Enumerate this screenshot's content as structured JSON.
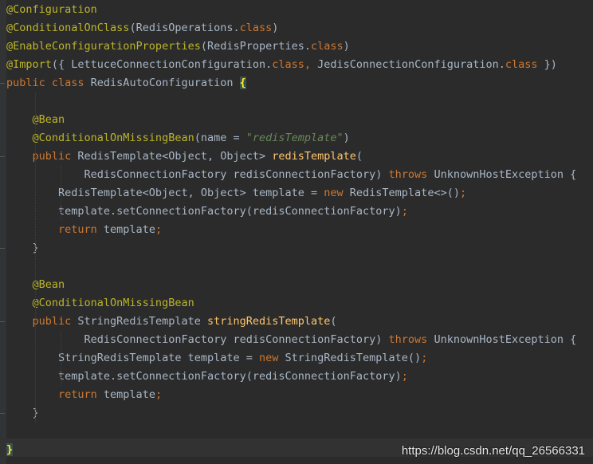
{
  "editor": {
    "lines": [
      [
        {
          "t": "@Configuration",
          "c": "ann"
        }
      ],
      [
        {
          "t": "@ConditionalOnClass",
          "c": "ann"
        },
        {
          "t": "(RedisOperations.",
          "c": "plain"
        },
        {
          "t": "class",
          "c": "kw"
        },
        {
          "t": ")",
          "c": "plain"
        }
      ],
      [
        {
          "t": "@EnableConfigurationProperties",
          "c": "ann"
        },
        {
          "t": "(RedisProperties.",
          "c": "plain"
        },
        {
          "t": "class",
          "c": "kw"
        },
        {
          "t": ")",
          "c": "plain"
        }
      ],
      [
        {
          "t": "@Import",
          "c": "ann"
        },
        {
          "t": "({ LettuceConnectionConfiguration.",
          "c": "plain"
        },
        {
          "t": "class",
          "c": "kw"
        },
        {
          "t": ", ",
          "c": "kw"
        },
        {
          "t": "JedisConnectionConfiguration.",
          "c": "plain"
        },
        {
          "t": "class",
          "c": "kw"
        },
        {
          "t": " })",
          "c": "plain"
        }
      ],
      [
        {
          "t": "public class ",
          "c": "kw"
        },
        {
          "t": "RedisAutoConfiguration ",
          "c": "plain"
        },
        {
          "t": "{",
          "c": "brace-hl"
        }
      ],
      [],
      [
        {
          "t": "    @Bean",
          "c": "ann"
        }
      ],
      [
        {
          "t": "    @ConditionalOnMissingBean",
          "c": "ann"
        },
        {
          "t": "(name = ",
          "c": "plain"
        },
        {
          "t": "\"redisTemplate\"",
          "c": "str"
        },
        {
          "t": ")",
          "c": "plain"
        }
      ],
      [
        {
          "t": "    public ",
          "c": "kw"
        },
        {
          "t": "RedisTemplate<Object, Object> ",
          "c": "plain"
        },
        {
          "t": "redisTemplate",
          "c": "fn"
        },
        {
          "t": "(",
          "c": "plain"
        }
      ],
      [
        {
          "t": "            RedisConnectionFactory redisConnectionFactory) ",
          "c": "plain"
        },
        {
          "t": "throws ",
          "c": "kw"
        },
        {
          "t": "UnknownHostException {",
          "c": "plain"
        }
      ],
      [
        {
          "t": "        RedisTemplate<Object, Object> template = ",
          "c": "plain"
        },
        {
          "t": "new ",
          "c": "kw"
        },
        {
          "t": "RedisTemplate<>()",
          "c": "plain"
        },
        {
          "t": ";",
          "c": "kw"
        }
      ],
      [
        {
          "t": "        template.setConnectionFactory(redisConnectionFactory)",
          "c": "plain"
        },
        {
          "t": ";",
          "c": "kw"
        }
      ],
      [
        {
          "t": "        return ",
          "c": "kw"
        },
        {
          "t": "template",
          "c": "plain"
        },
        {
          "t": ";",
          "c": "kw"
        }
      ],
      [
        {
          "t": "    }",
          "c": "plain"
        }
      ],
      [],
      [
        {
          "t": "    @Bean",
          "c": "ann"
        }
      ],
      [
        {
          "t": "    @ConditionalOnMissingBean",
          "c": "ann"
        }
      ],
      [
        {
          "t": "    public ",
          "c": "kw"
        },
        {
          "t": "StringRedisTemplate ",
          "c": "plain"
        },
        {
          "t": "stringRedisTemplate",
          "c": "fn"
        },
        {
          "t": "(",
          "c": "plain"
        }
      ],
      [
        {
          "t": "            RedisConnectionFactory redisConnectionFactory) ",
          "c": "plain"
        },
        {
          "t": "throws ",
          "c": "kw"
        },
        {
          "t": "UnknownHostException {",
          "c": "plain"
        }
      ],
      [
        {
          "t": "        StringRedisTemplate template = ",
          "c": "plain"
        },
        {
          "t": "new ",
          "c": "kw"
        },
        {
          "t": "StringRedisTemplate()",
          "c": "plain"
        },
        {
          "t": ";",
          "c": "kw"
        }
      ],
      [
        {
          "t": "        template.setConnectionFactory(redisConnectionFactory)",
          "c": "plain"
        },
        {
          "t": ";",
          "c": "kw"
        }
      ],
      [
        {
          "t": "        return ",
          "c": "kw"
        },
        {
          "t": "template",
          "c": "plain"
        },
        {
          "t": ";",
          "c": "kw"
        }
      ],
      [
        {
          "t": "    }",
          "c": "plain"
        }
      ],
      [],
      [
        {
          "t": "}",
          "c": "brace-hl"
        }
      ]
    ]
  },
  "colors": {
    "background": "#2b2b2b",
    "annotation": "#bbb529",
    "keyword": "#cc7832",
    "method": "#ffc66d",
    "string": "#6a8759",
    "text": "#a9b7c6"
  },
  "watermark": "https://blog.csdn.net/qq_26566331"
}
